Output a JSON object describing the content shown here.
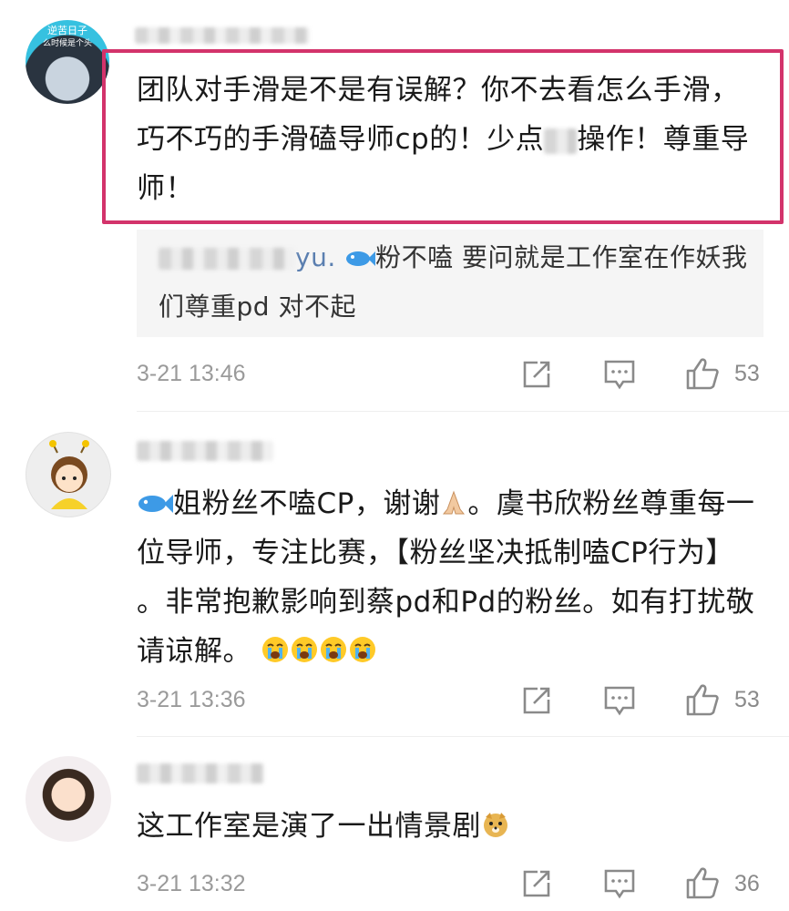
{
  "comments": [
    {
      "text": "团队对手滑是不是有误解？你不去看怎么手滑，巧不巧的手滑磕导师cp的！少点",
      "text_tail": "操作！尊重导师！",
      "avatar_caption_1": "逆苦日子",
      "avatar_caption_2": "么时候是个头",
      "reply_name_fragment": "yu.",
      "reply_text": "粉不嗑 要问就是工作室在作妖我们尊重pd 对不起",
      "time": "3-21 13:46",
      "likes": "53"
    },
    {
      "text_prefix_after_fish": "姐粉丝不嗑CP，谢谢",
      "text_rest": "。虞书欣粉丝尊重每一位导师，专注比赛，【粉丝坚决抵制嗑CP行为】 。非常抱歉影响到蔡pd和Pd的粉丝。如有打扰敬请谅解。",
      "time": "3-21 13:36",
      "likes": "53"
    },
    {
      "text": "这工作室是演了一出情景剧",
      "time": "3-21 13:32",
      "likes": "36"
    }
  ],
  "icons": {
    "share": "share-icon",
    "reply": "comment-icon",
    "like": "thumbs-up-icon"
  },
  "colors": {
    "highlight_border": "#d3336b",
    "reply_bg": "#f5f5f5"
  }
}
